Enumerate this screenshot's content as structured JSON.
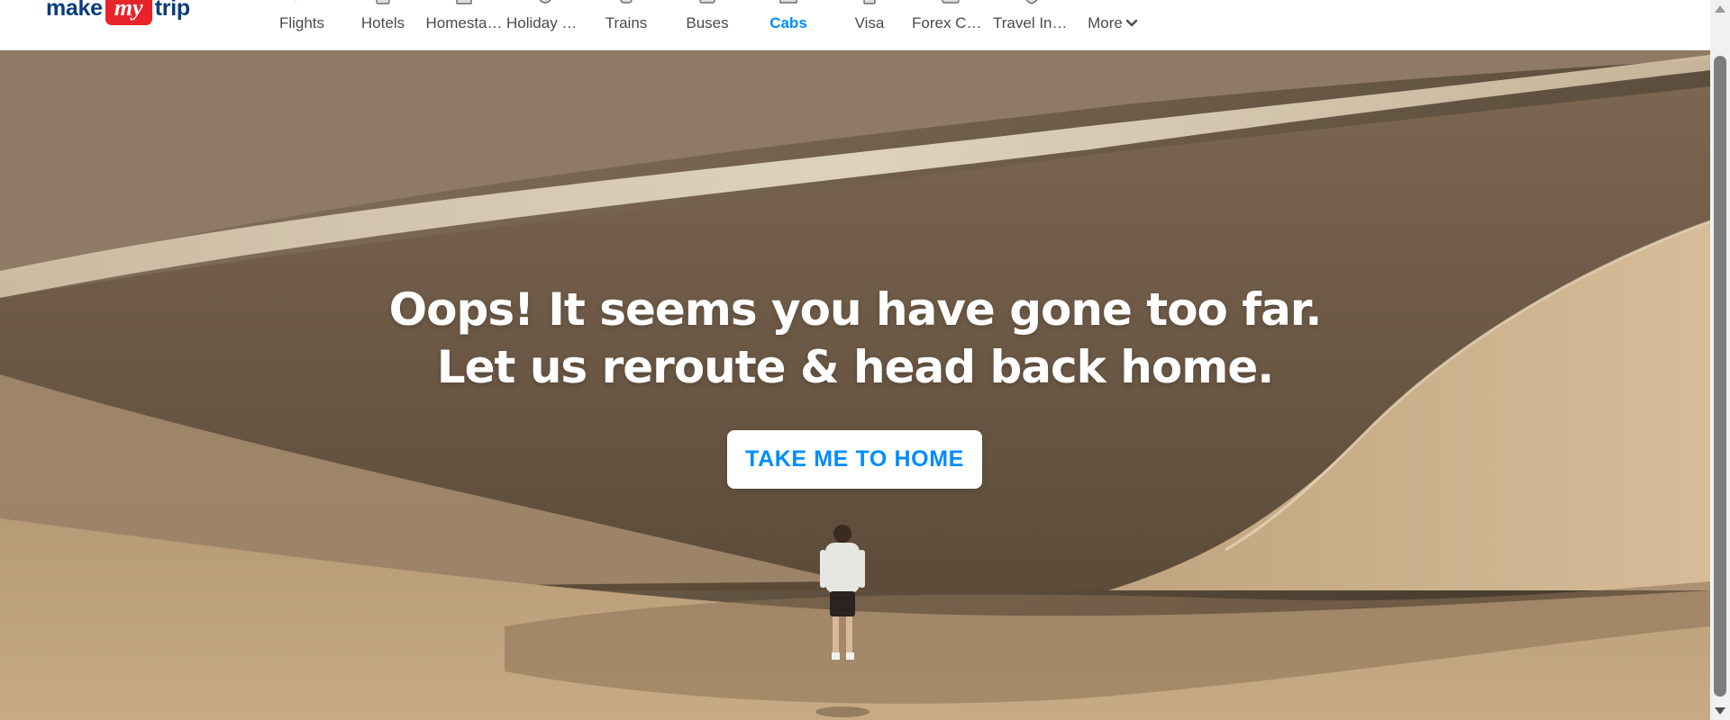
{
  "brand": {
    "make": "make",
    "my": "my",
    "trip": "trip",
    "accent": "#e8232a",
    "text_color": "#0a3d7a"
  },
  "nav": {
    "items": [
      {
        "label": "Flights",
        "icon": "flight-icon",
        "active": false
      },
      {
        "label": "Hotels",
        "icon": "hotel-icon",
        "active": false
      },
      {
        "label": "Homesta…",
        "icon": "homestay-icon",
        "active": false
      },
      {
        "label": "Holiday P…",
        "icon": "holiday-package-icon",
        "active": false
      },
      {
        "label": "Trains",
        "icon": "train-icon",
        "active": false
      },
      {
        "label": "Buses",
        "icon": "bus-icon",
        "active": false
      },
      {
        "label": "Cabs",
        "icon": "cab-icon",
        "active": true
      },
      {
        "label": "Visa",
        "icon": "visa-icon",
        "active": false
      },
      {
        "label": "Forex Ca…",
        "icon": "forex-card-icon",
        "active": false
      },
      {
        "label": "Travel Ins…",
        "icon": "travel-insurance-icon",
        "active": false
      }
    ],
    "more_label": "More",
    "active_color": "#008cff"
  },
  "hero": {
    "headline_line1": "Oops! It seems you have gone too far.",
    "headline_line2": "Let us reroute & head back home.",
    "cta_label": "TAKE ME TO HOME",
    "image": "desert-dunes-with-hiker"
  }
}
